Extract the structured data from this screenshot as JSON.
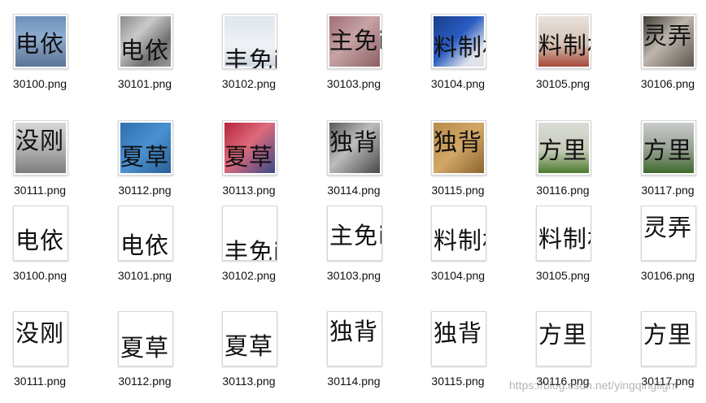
{
  "window": {
    "title": ""
  },
  "files": [
    {
      "name": "30100.png",
      "text": "电依",
      "bg": "linear-gradient(180deg,#6d8fb7 0%,#8eacd1 40%,#5c7596 100%)",
      "dark": false
    },
    {
      "name": "30101.png",
      "text": "电依",
      "bg": "linear-gradient(135deg,#8a8a8a 0%,#c9c9c9 35%,#6f6f6f 70%,#9b9b9b 100%)",
      "dark": false
    },
    {
      "name": "30102.png",
      "text": "丰免ii",
      "bg": "linear-gradient(180deg,#dfe6ee 0%,#eef2f6 60%,#cfd7df 100%)",
      "dark": false
    },
    {
      "name": "30103.png",
      "text": "主免ii",
      "bg": "linear-gradient(135deg,#9f6e74 0%,#c7a3a6 45%,#8a5f63 100%)",
      "dark": false
    },
    {
      "name": "30104.png",
      "text": "料制林",
      "bg": "linear-gradient(135deg,#1a3f8a 0%,#2a5cc2 45%,#dfe3e8 80%)",
      "dark": false
    },
    {
      "name": "30105.png",
      "text": "料制林",
      "bg": "linear-gradient(180deg,#e7e2dd 0%,#d6c3b3 55%,#a84a3a 100%)",
      "dark": false
    },
    {
      "name": "30106.png",
      "text": "灵弄",
      "bg": "linear-gradient(135deg,#3f3a35 0%,#bdb6ad 45%,#5e564e 100%)",
      "dark": false
    },
    {
      "name": "30111.png",
      "text": "没刚",
      "bg": "linear-gradient(180deg,#d7d7d7 0%,#a9a9a9 60%,#7d7d7d 100%)",
      "dark": false
    },
    {
      "name": "30112.png",
      "text": "夏草",
      "bg": "linear-gradient(135deg,#2e6fb0 0%,#4a91d0 50%,#2b5e97 100%)",
      "dark": false
    },
    {
      "name": "30113.png",
      "text": "夏草",
      "bg": "linear-gradient(135deg,#b3253c 0%,#e06a7c 45%,#3a4a8a 100%)",
      "dark": false
    },
    {
      "name": "30114.png",
      "text": "独背",
      "bg": "linear-gradient(135deg,#5a5a5a 0%,#bdbdbd 45%,#474747 100%)",
      "dark": false
    },
    {
      "name": "30115.png",
      "text": "独背",
      "bg": "linear-gradient(135deg,#b88a4a 0%,#d2a766 50%,#8a6431 100%)",
      "dark": false
    },
    {
      "name": "30116.png",
      "text": "方里",
      "bg": "linear-gradient(180deg,#d9dcd6 0%,#c7ccb9 55%,#4c7a2e 100%)",
      "dark": false
    },
    {
      "name": "30117.png",
      "text": "方里",
      "bg": "linear-gradient(180deg,#c9ccca 0%,#9aa396 50%,#3f6a2c 100%)",
      "dark": false
    },
    {
      "name": "30100.png",
      "text": "电依",
      "bg": "#ffffff",
      "dark": false
    },
    {
      "name": "30101.png",
      "text": "电依",
      "bg": "#ffffff",
      "dark": false
    },
    {
      "name": "30102.png",
      "text": "丰免ii",
      "bg": "#ffffff",
      "dark": false
    },
    {
      "name": "30103.png",
      "text": "主免ii",
      "bg": "#ffffff",
      "dark": false
    },
    {
      "name": "30104.png",
      "text": "料制林",
      "bg": "#ffffff",
      "dark": false
    },
    {
      "name": "30105.png",
      "text": "料制林",
      "bg": "#ffffff",
      "dark": false
    },
    {
      "name": "30106.png",
      "text": "灵弄",
      "bg": "#ffffff",
      "dark": false
    },
    {
      "name": "30111.png",
      "text": "没刚",
      "bg": "#ffffff",
      "dark": false
    },
    {
      "name": "30112.png",
      "text": "夏草",
      "bg": "#ffffff",
      "dark": false
    },
    {
      "name": "30113.png",
      "text": "夏草",
      "bg": "#ffffff",
      "dark": false
    },
    {
      "name": "30114.png",
      "text": "独背",
      "bg": "#ffffff",
      "dark": false
    },
    {
      "name": "30115.png",
      "text": "独背",
      "bg": "#ffffff",
      "dark": false
    },
    {
      "name": "30116.png",
      "text": "方里",
      "bg": "#ffffff",
      "dark": false
    },
    {
      "name": "30117.png",
      "text": "方里",
      "bg": "#ffffff",
      "dark": false
    }
  ],
  "watermark": "https://blog.csdn.net/yingqinglight"
}
